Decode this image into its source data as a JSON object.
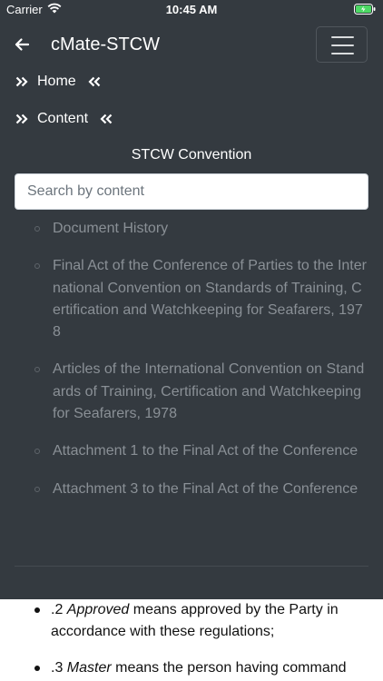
{
  "status": {
    "carrier": "Carrier",
    "time": "10:45 AM"
  },
  "navbar": {
    "title": "cMate-STCW"
  },
  "breadcrumbs": [
    {
      "label": "Home"
    },
    {
      "label": "Content"
    }
  ],
  "section_title": "STCW Convention",
  "search": {
    "placeholder": "Search by content",
    "value": ""
  },
  "documents": [
    "Document History",
    "Final Act of the Conference of Parties to the International Convention on Standards of Training, Certification and Watchkeeping for Seafarers, 1978",
    "Articles of the International Convention on Standards of Training, Certification and Watchkeeping for Seafarers, 1978",
    "Attachment 1 to the Final Act of the Conference",
    "Attachment 3 to the Final Act of the Conference"
  ],
  "content": {
    "item1": {
      "num": ".2 ",
      "term": "Approved",
      "rest": " means approved by the Party in accordance with these regulations;"
    },
    "item2": {
      "num": ".3 ",
      "term": "Master",
      "rest": " means the person having command"
    }
  }
}
